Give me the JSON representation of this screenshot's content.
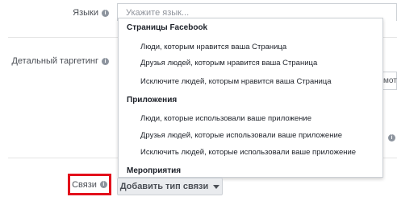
{
  "fields": {
    "languages_label": "Языки",
    "languages_placeholder": "Укажите язык...",
    "detailed_targeting_label": "Детальный таргетинг",
    "connections_label": "Связи",
    "add_connection_button": "Добавить тип связи",
    "side_input_text": "мот"
  },
  "dropdown": {
    "sections": [
      {
        "title": "Страницы Facebook",
        "options": [
          "Люди, которым нравится ваша Страница",
          "Друзья людей, которым нравится ваша Страница",
          "Исключите людей, которым нравится ваша Страница"
        ]
      },
      {
        "title": "Приложения",
        "options": [
          "Люди, которые использовали ваше приложение",
          "Друзья людей, которые использовали ваше приложение",
          "Исключить людей, которые использовали ваше приложение"
        ]
      },
      {
        "title": "Мероприятия",
        "options": []
      }
    ]
  },
  "colors": {
    "highlight_border": "#e3101b",
    "button_background": "#e9ebee"
  },
  "icons": {
    "info": "info-icon",
    "caret": "caret-down-icon"
  }
}
